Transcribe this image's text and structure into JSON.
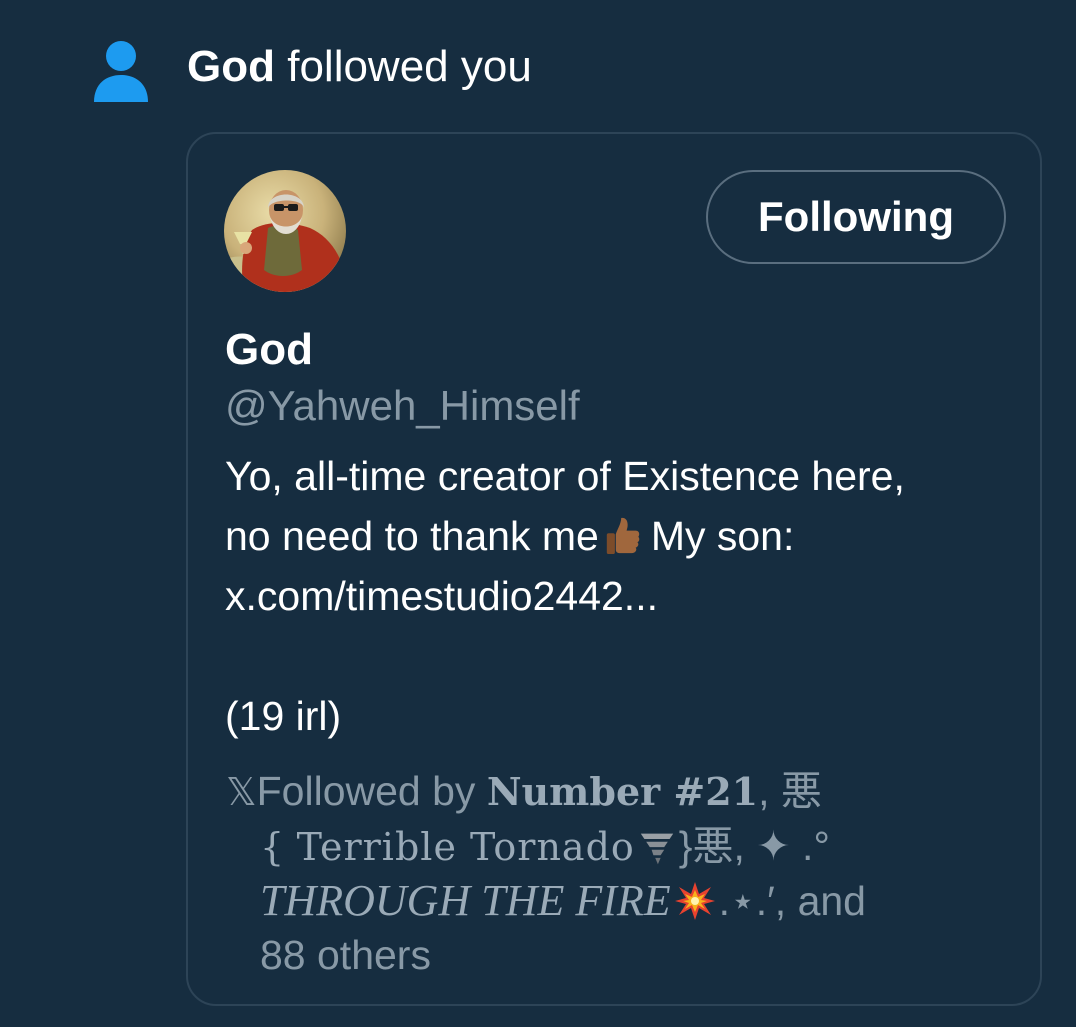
{
  "notification": {
    "actor": "God",
    "action": "followed you",
    "icon": "person-icon"
  },
  "profile": {
    "display_name": "God",
    "handle": "@Yahweh_Himself",
    "follow_button_label": "Following",
    "bio": {
      "line1": "Yo, all-time creator of Existence here,",
      "line2_before_emoji": "no need to thank me",
      "line2_after_emoji": "My son:",
      "line3": "x.com/timestudio2442...",
      "line4": "(19 irl)"
    },
    "followed_by": {
      "x_mark": "𝕏",
      "prefix": "Followed by",
      "follower1": "Number #21",
      "sep1": ", 悪",
      "follower2_open": "{",
      "follower2_name": "Terrible Tornado",
      "follower2_close": "}悪,",
      "sparkle": "✦",
      "dot_circle": ".°",
      "follower3": "THROUGH THE FIRE",
      "follower3_tail": ".⋆.′,",
      "and": "and",
      "others": "88 others"
    }
  },
  "colors": {
    "background": "#162d40",
    "accent_blue": "#1d9bf0",
    "muted_text": "#8899a6",
    "border": "#2d4457"
  }
}
